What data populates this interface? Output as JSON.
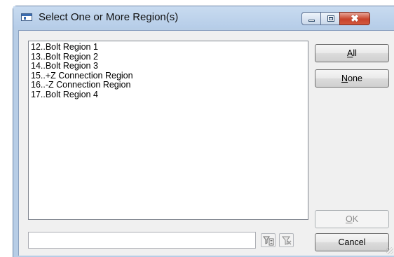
{
  "window": {
    "title": "Select One or More Region(s)",
    "close_glyph": "✖"
  },
  "regions": [
    "12..Bolt Region 1",
    "13..Bolt Region 2",
    "14..Bolt Region 3",
    "15..+Z Connection Region",
    "16..-Z Connection Region",
    "17..Bolt Region 4"
  ],
  "buttons": {
    "all": {
      "mnemonic": "A",
      "rest": "ll"
    },
    "none": {
      "mnemonic": "N",
      "rest": "one"
    },
    "ok": {
      "mnemonic": "O",
      "rest": "K"
    },
    "cancel": "Cancel"
  },
  "filter": {
    "value": "",
    "apply_icon": "filter-icon",
    "clear_icon": "clear-filter-icon"
  },
  "colors": {
    "titlebar": "#b6cde8",
    "close_button": "#c8432b",
    "dialog_background": "#f0f0f0"
  }
}
